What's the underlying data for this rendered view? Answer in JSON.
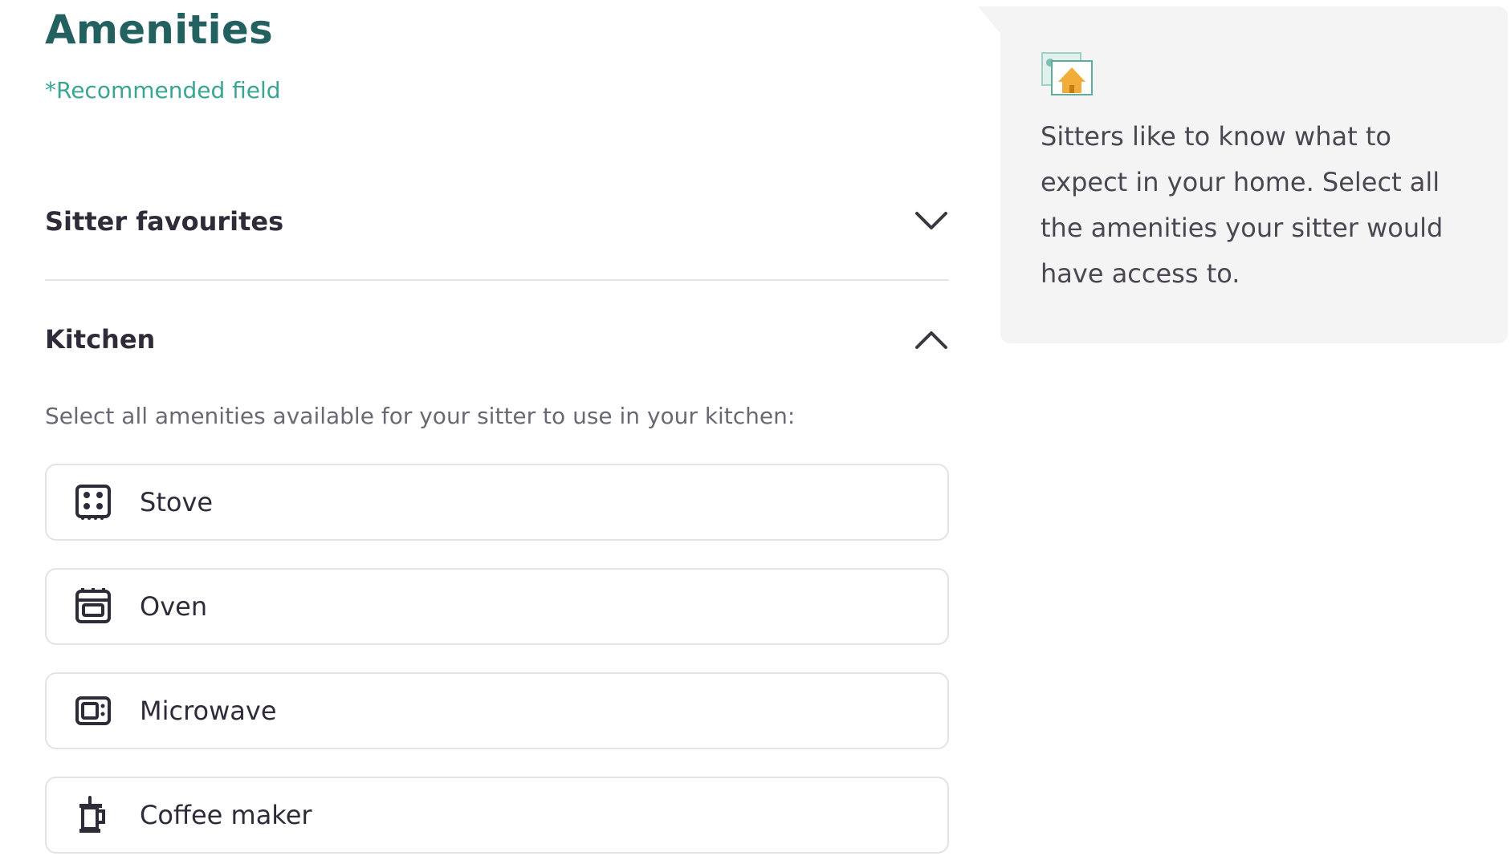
{
  "section": {
    "title": "Amenities",
    "recommended_note": "*Recommended field"
  },
  "accordions": {
    "sitter_favourites": {
      "title": "Sitter favourites",
      "expanded": false,
      "icon": "chevron-down-icon"
    },
    "kitchen": {
      "title": "Kitchen",
      "expanded": true,
      "icon": "chevron-up-icon",
      "instructions": "Select all amenities available for your sitter to use in your kitchen:",
      "options": [
        {
          "label": "Stove",
          "icon": "stove-icon",
          "selected": false
        },
        {
          "label": "Oven",
          "icon": "oven-icon",
          "selected": false
        },
        {
          "label": "Microwave",
          "icon": "microwave-icon",
          "selected": false
        },
        {
          "label": "Coffee maker",
          "icon": "coffee-maker-icon",
          "selected": false
        }
      ]
    }
  },
  "tip": {
    "icon": "house-picture-icon",
    "text": "Sitters like to know what to expect in your home. Select all the amenities your sitter would have access to."
  },
  "colors": {
    "title": "#22615f",
    "accent": "#3ba594",
    "text": "#2f2b38",
    "muted": "#6b6873",
    "border": "#e3e3e6",
    "tip_bg": "#f4f4f5"
  }
}
